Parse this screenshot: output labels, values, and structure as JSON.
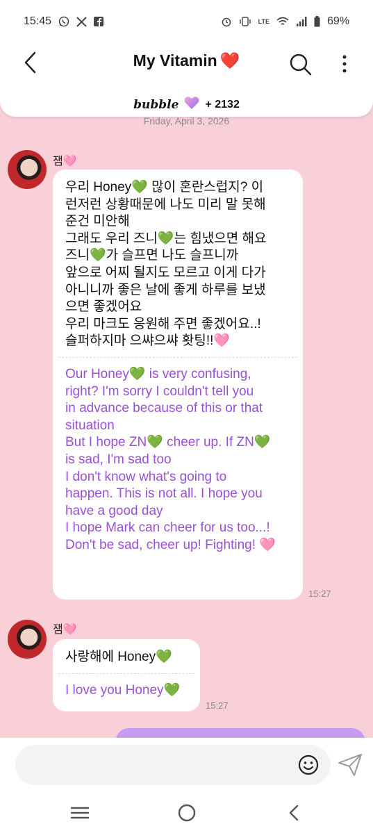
{
  "status_bar": {
    "time": "15:45",
    "battery": "69%",
    "network_label": "LTE"
  },
  "header": {
    "title": "My Vitamin",
    "title_emoji": "❤️",
    "bubble_brand": "bubble",
    "bubble_count": "+ 2132"
  },
  "date_label": "Friday, April 3, 2026",
  "messages": [
    {
      "sender": "잼",
      "sender_emoji": "🩷",
      "text_ko": "우리 Honey💚 많이 혼란스럽지? 이\n런저런 상황때문에 나도 미리 말 못해\n준건 미안해\n그래도 우리 즈니💚는 힘냈으면 해요\n즈니💚가 슬프면 나도 슬프니까\n앞으로 어찌 될지도 모르고 이게 다가\n아니니까 좋은 날에 좋게 하루를 보냈\n으면 좋겠어요\n우리 마크도 응원해 주면 좋겠어요..!\n슬퍼하지마 으쌰으쌰 홧팅!!🩷",
      "text_en": "Our Honey💚 is very confusing,\nright? I'm sorry I couldn't tell you\nin advance because of this or that\nsituation\nBut I hope ZN💚 cheer up. If ZN💚\nis sad, I'm sad too\nI don't know what's going to\nhappen. This is not all. I hope you\nhave a good day\nI hope Mark can cheer for us too...!\nDon't be sad, cheer up! Fighting! 🩷",
      "time": "15:27"
    },
    {
      "sender": "잼",
      "sender_emoji": "🩷",
      "text_ko": "사랑해에 Honey💚",
      "text_en": "I love you Honey💚",
      "time": "15:27"
    }
  ],
  "composer": {
    "placeholder": ""
  },
  "colors": {
    "background": "#f9cfd8",
    "translation_text": "#9a4fd8",
    "outgoing_bubble": "#c49cf2"
  },
  "icons": [
    "whatsapp-icon",
    "x-icon",
    "facebook-icon",
    "alarm-icon",
    "vibrate-icon",
    "wifi-icon",
    "signal-icon",
    "battery-icon",
    "back-arrow-icon",
    "search-icon",
    "more-vertical-icon",
    "emoji-icon",
    "send-icon",
    "recents-icon",
    "home-icon",
    "nav-back-icon"
  ]
}
